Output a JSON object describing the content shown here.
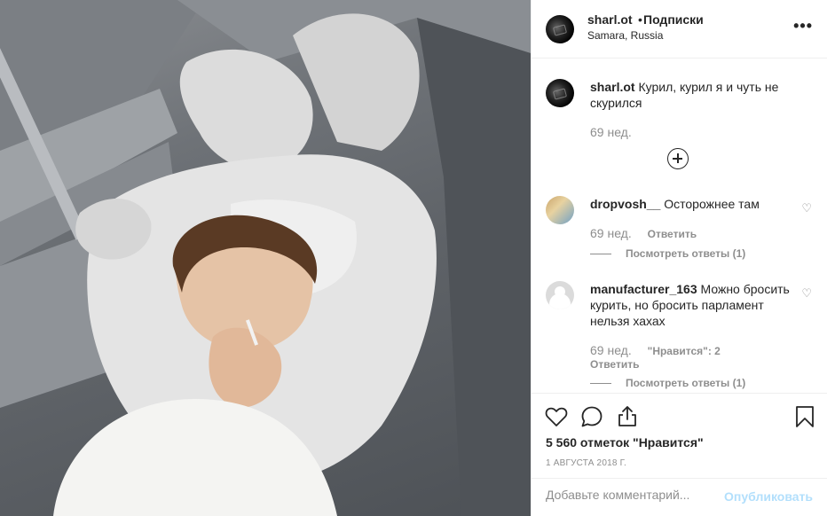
{
  "post": {
    "username": "sharl.ot",
    "separator": "•",
    "follow_label": "Подписки",
    "location": "Samara, Russia",
    "more_label": "•••"
  },
  "caption": {
    "username": "sharl.ot",
    "text": "Курил, курил я и чуть не скурился",
    "time": "69 нед."
  },
  "comments": [
    {
      "username": "dropvosh__",
      "text": "Осторожнее там",
      "time": "69 нед.",
      "reply_label": "Ответить",
      "likes_label": "",
      "view_replies": "Посмотреть ответы (1)"
    },
    {
      "username": "manufacturer_163",
      "text": "Можно бросить курить, но бросить парламент нельзя хахах",
      "time": "69 нед.",
      "likes_label": "\"Нравится\": 2",
      "reply_label": "Ответить",
      "view_replies": "Посмотреть ответы (1)"
    }
  ],
  "stats": {
    "likes": "5 560 отметок \"Нравится\"",
    "date": "1 АВГУСТА 2018 Г."
  },
  "comment_box": {
    "placeholder": "Добавьте комментарий...",
    "publish_label": "Опубликовать"
  },
  "icons": [
    "heart-icon",
    "comment-icon",
    "share-icon",
    "bookmark-icon",
    "plus-circle-icon",
    "more-icon"
  ],
  "colors": {
    "link_disabled": "#b2dffc",
    "muted": "#8e8e8e",
    "text": "#262626"
  }
}
